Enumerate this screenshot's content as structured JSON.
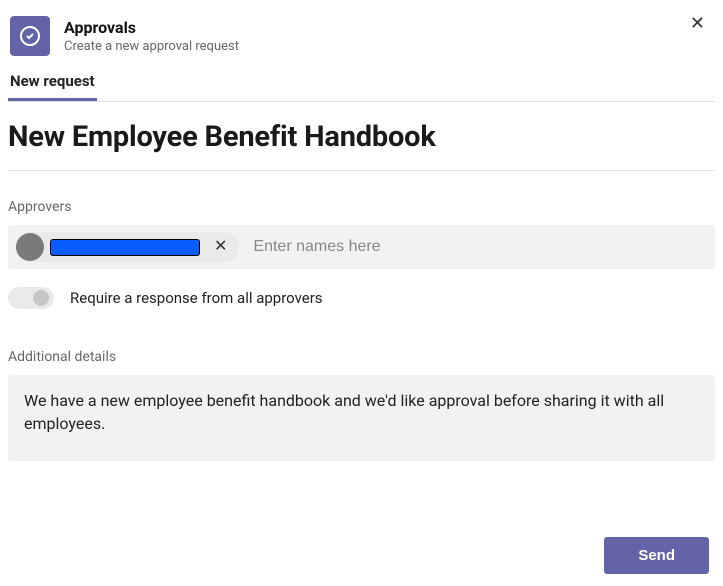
{
  "header": {
    "app_title": "Approvals",
    "app_subtitle": "Create a new approval request"
  },
  "tabs": {
    "active": "New request"
  },
  "request": {
    "title": "New Employee Benefit Handbook"
  },
  "approvers": {
    "label": "Approvers",
    "placeholder": "Enter names here",
    "selected": [
      {
        "name_redacted": true
      }
    ],
    "require_all_label": "Require a response from all approvers",
    "require_all_value": false
  },
  "details": {
    "label": "Additional details",
    "value": "We have a new employee benefit handbook and we'd like approval before sharing it with all employees."
  },
  "actions": {
    "send_label": "Send"
  }
}
